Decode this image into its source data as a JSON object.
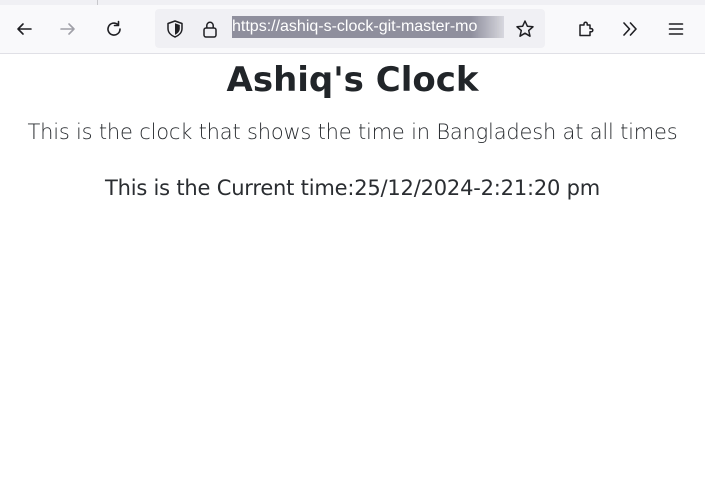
{
  "browser": {
    "url": "https://ashiq-s-clock-git-master-mo",
    "toolbar_icons": [
      "back-arrow-icon",
      "forward-arrow-icon",
      "reload-icon",
      "shield-icon",
      "lock-icon",
      "star-icon",
      "extensions-icon",
      "overflow-chevrons-icon",
      "menu-icon"
    ],
    "colors": {
      "toolbar_bg": "#f9f9fb",
      "urlbar_bg": "#f0f0f4",
      "url_selection": "#8f8f9d"
    }
  },
  "page": {
    "title": "Ashiq's Clock",
    "description": "This is the clock that shows the time in Bangladesh at all times",
    "time_prefix": "This is the Current time:",
    "current_time": "25/12/2024-2:21:20 pm"
  }
}
